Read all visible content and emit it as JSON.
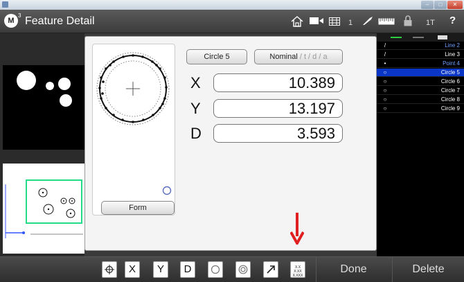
{
  "window": {
    "app_title": "Feature Detail",
    "logo_letter": "M",
    "logo_superscript": "3"
  },
  "toolbar": {
    "count_label": "1",
    "tool_label": "1T",
    "help_label": "?",
    "icons": [
      "home-icon",
      "camera-icon",
      "grid-icon",
      "probe-icon",
      "ruler-icon",
      "lock-icon"
    ]
  },
  "detail": {
    "feature_name": "Circle 5",
    "nominal_label": "Nominal",
    "nominal_suffix": " / t / d / a",
    "form_label": "Form",
    "rows": [
      {
        "label": "X",
        "value": "10.389"
      },
      {
        "label": "Y",
        "value": "13.197"
      },
      {
        "label": "D",
        "value": "3.593"
      }
    ]
  },
  "feature_list": [
    {
      "icon": "line-icon",
      "glyph": "/",
      "name": "Line 2",
      "blue": true,
      "selected": false
    },
    {
      "icon": "line-icon",
      "glyph": "/",
      "name": "Line 3",
      "blue": false,
      "selected": false
    },
    {
      "icon": "point-icon",
      "glyph": "•",
      "name": "Point 4",
      "blue": true,
      "selected": false
    },
    {
      "icon": "circle-icon",
      "glyph": "○",
      "name": "Circle 5",
      "blue": false,
      "selected": true
    },
    {
      "icon": "circle-icon",
      "glyph": "○",
      "name": "Circle 6",
      "blue": false,
      "selected": false
    },
    {
      "icon": "circle-icon",
      "glyph": "○",
      "name": "Circle 7",
      "blue": false,
      "selected": false
    },
    {
      "icon": "circle-icon",
      "glyph": "○",
      "name": "Circle 8",
      "blue": false,
      "selected": false
    },
    {
      "icon": "circle-icon",
      "glyph": "○",
      "name": "Circle 9",
      "blue": false,
      "selected": false
    }
  ],
  "bottom": {
    "x_label": "X",
    "y_label": "Y",
    "d_label": "D",
    "decimal_label": "X.X X.XX X.XXX",
    "done_label": "Done",
    "delete_label": "Delete"
  },
  "colors": {
    "selection": "#0a36c8",
    "accent_blue": "#6fa0ff",
    "arrow_red": "#e02020",
    "preview_green": "#22dd88"
  }
}
